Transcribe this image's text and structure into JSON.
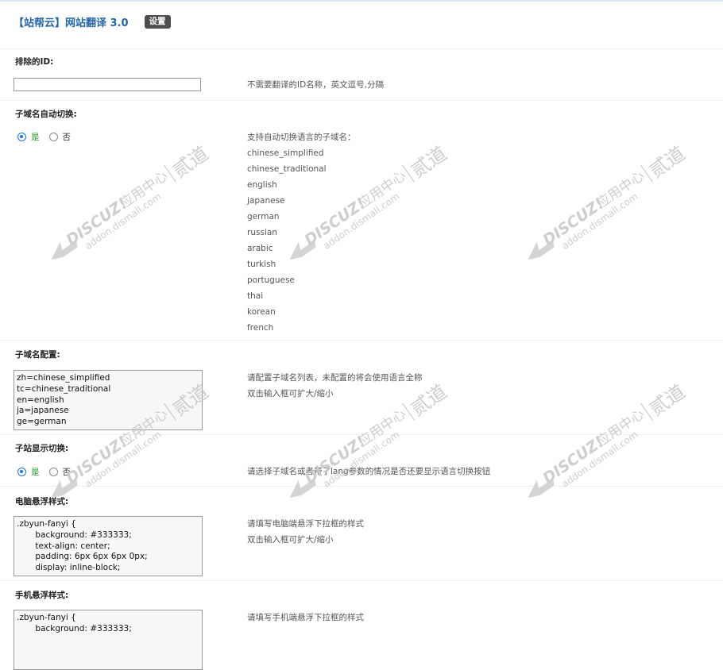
{
  "header": {
    "title": "【站帮云】网站翻译 3.0",
    "badge": "设置"
  },
  "sections": {
    "exclude_id": {
      "label": "排除的ID:",
      "value": "",
      "tip": "不需要翻译的ID名称，英文逗号,分隔"
    },
    "subdomain_auto": {
      "label": "子域名自动切换:",
      "yes": "是",
      "no": "否",
      "selected": "yes",
      "tip_title": "支持自动切换语言的子域名：",
      "languages": [
        "chinese_simplified",
        "chinese_traditional",
        "english",
        "japanese",
        "german",
        "russian",
        "arabic",
        "turkish",
        "portuguese",
        "thai",
        "korean",
        "french"
      ]
    },
    "subdomain_config": {
      "label": "子域名配置:",
      "lines": [
        "zh=chinese_simplified",
        "tc=chinese_traditional",
        "en=english",
        "ja=japanese",
        "ge=german"
      ],
      "tip1": "请配置子域名列表，未配置的将会使用语言全称",
      "tip2": "双击输入框可扩大/缩小"
    },
    "substation_display": {
      "label": "子站显示切换:",
      "yes": "是",
      "no": "否",
      "selected": "yes",
      "tip": "请选择子域名或者带了lang参数的情况是否还要显示语言切换按钮"
    },
    "pc_style": {
      "label": "电脑悬浮样式:",
      "lines": [
        ".zbyun-fanyi {",
        "       background: #333333;",
        "       text-align: center;",
        "       padding: 6px 6px 6px 0px;",
        "       display: inline-block;"
      ],
      "tip1": "请填写电脑端悬浮下拉框的样式",
      "tip2": "双击输入框可扩大/缩小"
    },
    "mobile_style": {
      "label": "手机悬浮样式:",
      "lines": [
        ".zbyun-fanyi {",
        "       background: #333333;"
      ],
      "tip1": "请填写手机端悬浮下拉框的样式"
    }
  },
  "watermark": {
    "brand": "DISCUZ!",
    "cn": "应用中心",
    "site": "addon.dismall.com",
    "mark": "贰道"
  },
  "colors": {
    "accent": "#2366a8",
    "radio": "#1a73e8",
    "yes_text": "#2aa52a",
    "badge_bg": "#4d4d4d"
  }
}
